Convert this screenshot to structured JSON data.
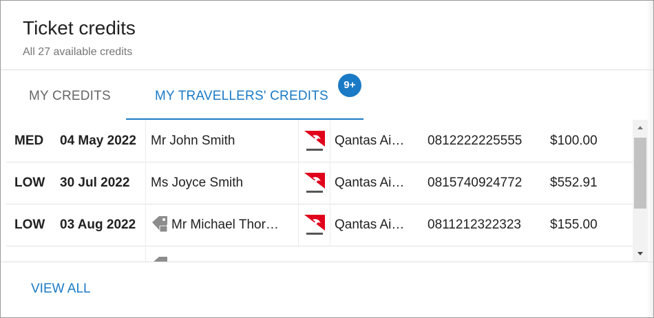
{
  "header": {
    "title": "Ticket credits",
    "subtitle": "All 27 available credits"
  },
  "tabs": [
    {
      "label": "MY CREDITS",
      "active": false
    },
    {
      "label": "MY TRAVELLERS' CREDITS",
      "active": true,
      "badge": "9+"
    }
  ],
  "colors": {
    "accent": "#1a7ac5",
    "priority_med": "#f0893a",
    "priority_low": "#6aa332",
    "qantas_red": "#e0001b"
  },
  "credits": [
    {
      "priority": "MED",
      "expiry": "04 May 2022",
      "traveller": "Mr John Smith",
      "has_tag_icon": false,
      "airline_icon": "qantas-logo-icon",
      "airline": "Qantas Ai…",
      "ticket_number": "0812222225555",
      "amount": "$100.00"
    },
    {
      "priority": "LOW",
      "expiry": "30 Jul 2022",
      "traveller": "Ms Joyce Smith",
      "has_tag_icon": false,
      "airline_icon": "qantas-logo-icon",
      "airline": "Qantas Ai…",
      "ticket_number": "0815740924772",
      "amount": "$552.91"
    },
    {
      "priority": "LOW",
      "expiry": "03 Aug 2022",
      "traveller": "Mr Michael Thor…",
      "has_tag_icon": true,
      "airline_icon": "qantas-logo-icon",
      "airline": "Qantas Ai…",
      "ticket_number": "0811212322323",
      "amount": "$155.00"
    }
  ],
  "footer": {
    "view_all_label": "VIEW ALL"
  }
}
